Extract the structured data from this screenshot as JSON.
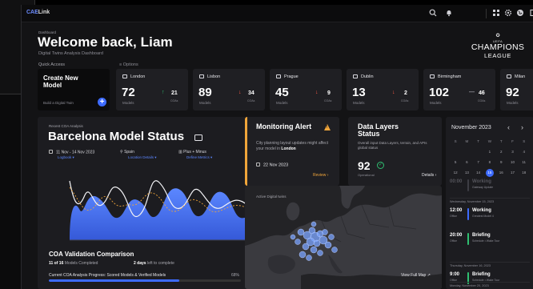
{
  "app": {
    "logo_brand": "CAE",
    "logo_rest": "Link",
    "icons": [
      "search-icon",
      "bell-icon",
      "apps-icon",
      "settings-icon",
      "globe-icon",
      "panel-icon"
    ]
  },
  "header": {
    "breadcrumb": "Dashboard",
    "welcome": "Welcome back, Liam",
    "subtitle": "Digital Twins Analysis Dashboard",
    "quick_access": "Quick Access",
    "options": "Options"
  },
  "brand": {
    "uefa": "UEFA",
    "main": "CHAMPIONS",
    "sub": "LEAGUE"
  },
  "create": {
    "title": "Create New Model",
    "subtitle": "Build a Digital Twin",
    "button": "+"
  },
  "cities": [
    {
      "name": "London",
      "count": "72",
      "label": "Models",
      "delta": "21",
      "delta_label": "COAs",
      "trend": "up"
    },
    {
      "name": "Lisbon",
      "count": "89",
      "label": "Models",
      "delta": "34",
      "delta_label": "COAs",
      "trend": "down"
    },
    {
      "name": "Prague",
      "count": "45",
      "label": "Models",
      "delta": "9",
      "delta_label": "COAs",
      "trend": "down"
    },
    {
      "name": "Dublin",
      "count": "13",
      "label": "Models",
      "delta": "2",
      "delta_label": "COAs",
      "trend": "down"
    },
    {
      "name": "Birmingham",
      "count": "102",
      "label": "Models",
      "delta": "46",
      "delta_label": "COAs",
      "trend": "flat"
    },
    {
      "name": "Milan",
      "count": "92",
      "label": "Models",
      "delta": "",
      "delta_label": "",
      "trend": "none"
    }
  ],
  "analysis": {
    "kicker": "Recent COA Analysis",
    "title": "Barcelona Model Status",
    "date_range": "11 Nov - 14 Nov 2023",
    "date_link": "Logbook",
    "location": "Spain",
    "location_link": "Location Details",
    "metric": "Plus + Minus",
    "metric_link": "Define Metrics",
    "validation_title": "COA Validation Comparison",
    "models_completed_count": "11 of 16",
    "models_completed_label": "Models Completed",
    "days_left_count": "2 days",
    "days_left_label": "left to complete",
    "progress_label": "Current COA Analysis Progress: Scored Models & Verified Models",
    "progress_text": "68%",
    "progress_value": 0.68
  },
  "monitoring": {
    "title": "Monitoring Alert",
    "body_prefix": "City planning layout updates might affect your model in",
    "body_city": "London",
    "date": "22 Nov 2023",
    "review": "Review",
    "accent": "#f0a53a"
  },
  "datalayers": {
    "title": "Data Layers Status",
    "body": "Overall input Data Layers, terrain, and APIs global status",
    "value": "92",
    "value_label": "Operational",
    "details": "Details",
    "status_color": "#2fbf71"
  },
  "map": {
    "label": "Active Digital twins",
    "view_full": "View Full Map"
  },
  "calendar": {
    "month": "November 2023",
    "weekdays": [
      "S",
      "M",
      "T",
      "W",
      "T",
      "F",
      "S"
    ],
    "weeks": [
      [
        "",
        "",
        "",
        "1",
        "2",
        "3",
        "4"
      ],
      [
        "5",
        "6",
        "7",
        "8",
        "9",
        "10",
        "11"
      ],
      [
        "12",
        "13",
        "14",
        "15",
        "16",
        "17",
        "18"
      ]
    ],
    "selected_day": "15",
    "events": [
      {
        "day": "",
        "time": "00:00",
        "time_sub": "",
        "title": "Working",
        "sub": "Gateway Update",
        "color": "#3d3d44",
        "dim": true
      },
      {
        "day": "Wednesday, November 15, 2023",
        "time": "12:00",
        "time_sub": "Office",
        "title": "Working",
        "sub": "Greatest Model 4",
        "color": "#3d6bff",
        "dim": false
      },
      {
        "day": "",
        "time": "20:00",
        "time_sub": "Office",
        "title": "Briefing",
        "sub": "Schedule • Wake Tour",
        "color": "#2fbf71",
        "dim": false
      },
      {
        "day": "Thursday, November 16, 2023",
        "time": "9:00",
        "time_sub": "Office",
        "title": "Briefing",
        "sub": "Schedule • Wake Tour",
        "color": "#2fbf71",
        "dim": false
      },
      {
        "day": "Monday, November 20, 2023",
        "time": "",
        "time_sub": "",
        "title": "",
        "sub": "",
        "color": "#2fbf71",
        "dim": false
      }
    ]
  },
  "colors": {
    "accent": "#3d6bff",
    "up": "#2fbf71",
    "down": "#ff5a45",
    "flat": "#9a9aa2",
    "warning": "#f0a53a"
  }
}
